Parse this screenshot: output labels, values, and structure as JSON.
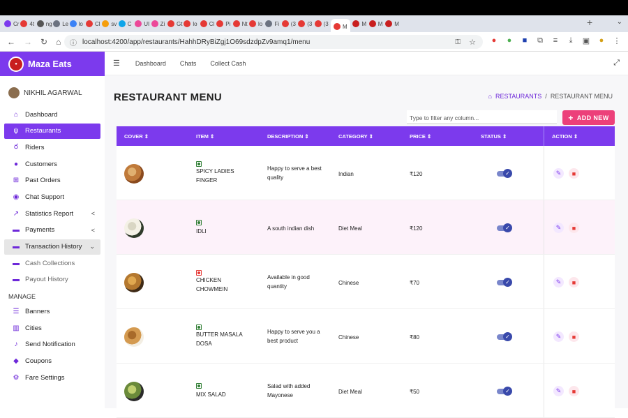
{
  "browser": {
    "url": "localhost:4200/app/restaurants/HahhDRyBiZgj1O69sdzdpZv9amq1/menu",
    "tabs": [
      "Cr",
      "4t",
      "ng",
      "Le",
      "lo",
      "Cl",
      "sv",
      "C",
      "UI",
      "Zi",
      "Gt",
      "lo",
      "Cl",
      "Pi",
      "Nt",
      "lo",
      "Fi",
      "(3",
      "(3",
      "(3",
      "M",
      "M",
      "M",
      "M"
    ],
    "active_tab_label": "M"
  },
  "sidebar": {
    "brand": "Maza Eats",
    "logo_text": "Maza Eats",
    "user_name": "NIKHIL AGARWAL",
    "items": [
      {
        "label": "Dashboard",
        "icon": "home-icon"
      },
      {
        "label": "Restaurants",
        "icon": "utensils-icon"
      },
      {
        "label": "Riders",
        "icon": "bicycle-icon"
      },
      {
        "label": "Customers",
        "icon": "user-icon"
      },
      {
        "label": "Past Orders",
        "icon": "cart-icon"
      },
      {
        "label": "Chat Support",
        "icon": "chat-icon"
      },
      {
        "label": "Statistics Report",
        "icon": "chart-icon"
      },
      {
        "label": "Payments",
        "icon": "money-icon"
      },
      {
        "label": "Transaction History",
        "icon": "money-icon"
      },
      {
        "label": "Cash Collections",
        "icon": "money-icon"
      },
      {
        "label": "Payout History",
        "icon": "money-icon"
      }
    ],
    "manage_label": "MANAGE",
    "manage_items": [
      {
        "label": "Banners",
        "icon": "list-icon"
      },
      {
        "label": "Cities",
        "icon": "city-icon"
      },
      {
        "label": "Send Notification",
        "icon": "bell-icon"
      },
      {
        "label": "Coupons",
        "icon": "tag-icon"
      },
      {
        "label": "Fare Settings",
        "icon": "gear-icon"
      }
    ]
  },
  "topnav": {
    "links": [
      "Dashboard",
      "Chats",
      "Collect Cash"
    ]
  },
  "page": {
    "title": "RESTAURANT MENU",
    "breadcrumb_link": "RESTAURANTS",
    "breadcrumb_sep": "/",
    "breadcrumb_current": "RESTAURANT MENU",
    "filter_placeholder": "Type to filter any column...",
    "add_new_label": "ADD NEW"
  },
  "table": {
    "columns": [
      "COVER ⇕",
      "ITEM ⇕",
      "DESCRIPTION ⇕",
      "CATEGORY ⇕",
      "PRICE ⇕",
      "STATUS ⇕",
      "ACTION ⇕"
    ],
    "rows": [
      {
        "item": "SPICY LADIES FINGER",
        "veg": true,
        "description": "Happy to serve a best quality",
        "category": "Indian",
        "price": "₹120",
        "status": true,
        "colors": [
          "#c07a3a",
          "#8a4a1e",
          "#e0b070"
        ]
      },
      {
        "item": "IDLI",
        "veg": true,
        "description": "A south indian dish",
        "category": "Diet Meal",
        "price": "₹120",
        "status": true,
        "colors": [
          "#f4f1e6",
          "#2f3a2a",
          "#d9d6c4"
        ]
      },
      {
        "item": "CHICKEN CHOWMEIN",
        "veg": false,
        "description": "Available in good quantity",
        "category": "Chinese",
        "price": "₹70",
        "status": true,
        "colors": [
          "#b4782f",
          "#3e2a16",
          "#e0a850"
        ]
      },
      {
        "item": "BUTTER MASALA DOSA",
        "veg": true,
        "description": "Happy to serve you a best product",
        "category": "Chinese",
        "price": "₹80",
        "status": true,
        "colors": [
          "#d49a50",
          "#f3eee3",
          "#a86a2a"
        ]
      },
      {
        "item": "MIX SALAD",
        "veg": true,
        "description": "Salad with added Mayonese",
        "category": "Diet Meal",
        "price": "₹50",
        "status": true,
        "colors": [
          "#6a8a3a",
          "#2a2a2a",
          "#c0d070"
        ]
      }
    ]
  },
  "colors": {
    "brand": "#7c3aed",
    "accent_pink": "#ec407a",
    "toggle": "#3949ab"
  }
}
